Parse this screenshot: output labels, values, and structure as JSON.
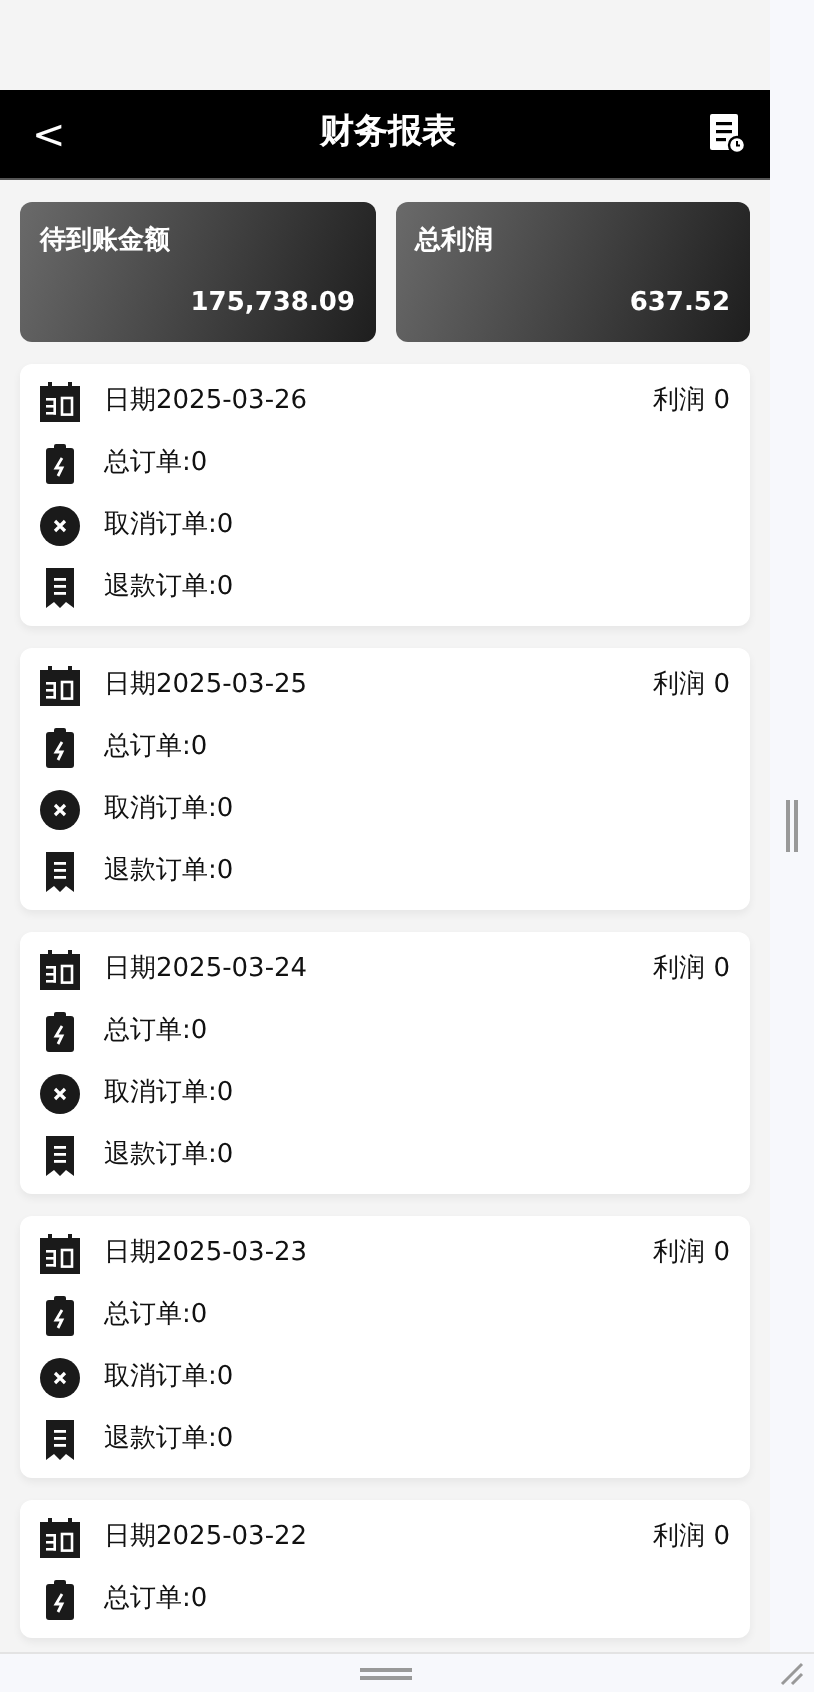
{
  "header": {
    "back": "<",
    "title": "财务报表"
  },
  "summary": [
    {
      "label": "待到账金额",
      "value": "175,738.09"
    },
    {
      "label": "总利润",
      "value": "637.52"
    }
  ],
  "records": [
    {
      "date": "日期2025-03-26",
      "profit": "利润 0",
      "lines": [
        {
          "kind": "total",
          "text": "总订单:0"
        },
        {
          "kind": "cancel",
          "text": "取消订单:0"
        },
        {
          "kind": "refund",
          "text": "退款订单:0"
        }
      ]
    },
    {
      "date": "日期2025-03-25",
      "profit": "利润 0",
      "lines": [
        {
          "kind": "total",
          "text": "总订单:0"
        },
        {
          "kind": "cancel",
          "text": "取消订单:0"
        },
        {
          "kind": "refund",
          "text": "退款订单:0"
        }
      ]
    },
    {
      "date": "日期2025-03-24",
      "profit": "利润 0",
      "lines": [
        {
          "kind": "total",
          "text": "总订单:0"
        },
        {
          "kind": "cancel",
          "text": "取消订单:0"
        },
        {
          "kind": "refund",
          "text": "退款订单:0"
        }
      ]
    },
    {
      "date": "日期2025-03-23",
      "profit": "利润 0",
      "lines": [
        {
          "kind": "total",
          "text": "总订单:0"
        },
        {
          "kind": "cancel",
          "text": "取消订单:0"
        },
        {
          "kind": "refund",
          "text": "退款订单:0"
        }
      ]
    },
    {
      "date": "日期2025-03-22",
      "profit": "利润 0",
      "lines": [
        {
          "kind": "total",
          "text": "总订单:0"
        }
      ]
    }
  ]
}
